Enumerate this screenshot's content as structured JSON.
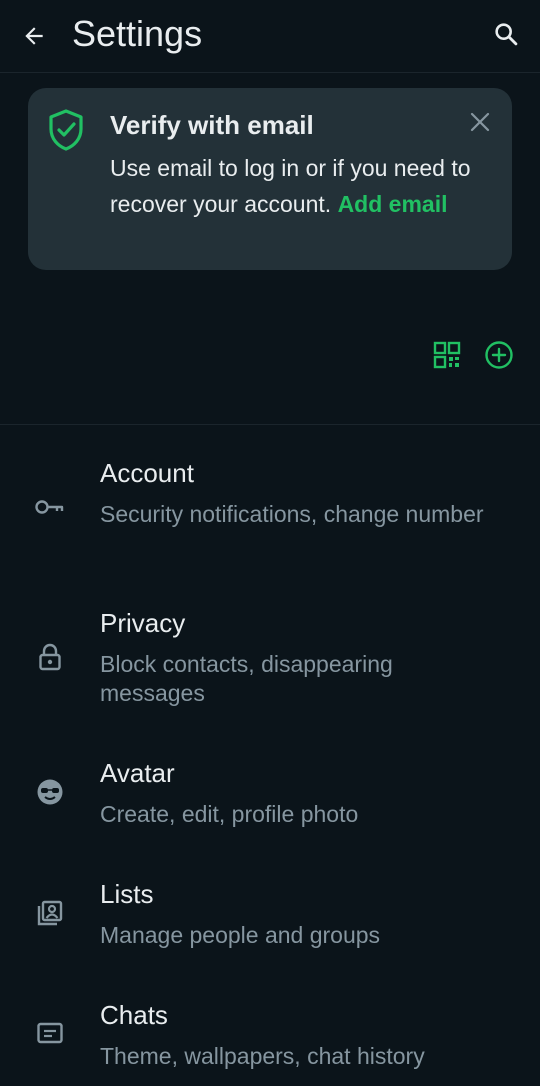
{
  "header": {
    "title": "Settings"
  },
  "banner": {
    "title": "Verify with email",
    "body": "Use email to log in or if you need to recover your account. ",
    "link": "Add email"
  },
  "items": [
    {
      "title": "Account",
      "subtitle": "Security notifications, change number",
      "icon": "key-icon"
    },
    {
      "title": "Privacy",
      "subtitle": "Block contacts, disappearing messages",
      "icon": "lock-icon"
    },
    {
      "title": "Avatar",
      "subtitle": "Create, edit, profile photo",
      "icon": "avatar-icon"
    },
    {
      "title": "Lists",
      "subtitle": "Manage people and groups",
      "icon": "lists-icon"
    },
    {
      "title": "Chats",
      "subtitle": "Theme, wallpapers, chat history",
      "icon": "chat-icon"
    }
  ],
  "colors": {
    "background": "#0b141a",
    "banner": "#233138",
    "accent": "#21c063",
    "primary_text": "#e9edef",
    "secondary_text": "#8696a0"
  }
}
